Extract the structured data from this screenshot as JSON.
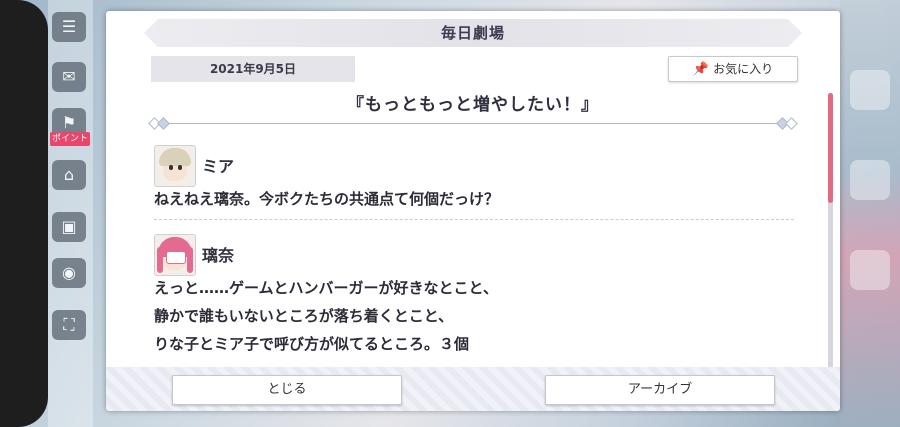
{
  "dialog": {
    "title": "毎日劇場",
    "date": "2021年9月5日",
    "favorite_label": "お気に入り",
    "episode_title": "『もっともっと増やしたい！』"
  },
  "entries": [
    {
      "speaker": "ミア",
      "lines": [
        "ねえねえ璃奈。今ボクたちの共通点て何個だっけ？"
      ]
    },
    {
      "speaker": "璃奈",
      "lines": [
        "えっと……ゲームとハンバーガーが好きなとこと、",
        "静かで誰もいないところが落ち着くとこと、",
        "りな子とミア子で呼び方が似てるところ。３個"
      ]
    }
  ],
  "buttons": {
    "close_label": "とじる",
    "archive_label": "アーカイブ"
  },
  "side_menu": {
    "point_tag": "ポイント"
  },
  "colors": {
    "accent": "#e06a82",
    "title_text": "#3c3c50",
    "body_text": "#2c2c38"
  },
  "scroll": {
    "position_fraction": 0.0,
    "visible_fraction": 0.4
  }
}
